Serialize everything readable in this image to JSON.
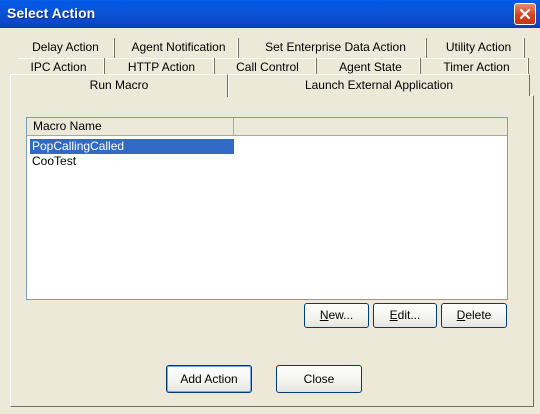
{
  "window": {
    "title": "Select Action"
  },
  "tabs": {
    "row1": [
      "Delay Action",
      "Agent Notification",
      "Set Enterprise Data Action",
      "Utility Action"
    ],
    "row2": [
      "IPC Action",
      "HTTP Action",
      "Call Control",
      "Agent State",
      "Timer Action"
    ],
    "row3": [
      "Run Macro",
      "Launch External Application"
    ],
    "active": "Run Macro"
  },
  "macro_list": {
    "columns": [
      "Macro Name",
      ""
    ],
    "rows": [
      {
        "name": "PopCallingCalled",
        "selected": true
      },
      {
        "name": "CooTest",
        "selected": false
      }
    ]
  },
  "list_buttons": {
    "new": {
      "label": "New...",
      "mnemonic": "N"
    },
    "edit": {
      "label": "Edit...",
      "mnemonic": "E"
    },
    "delete": {
      "label": "Delete",
      "mnemonic": "D"
    }
  },
  "footer_buttons": {
    "add_action": "Add Action",
    "close": "Close"
  },
  "colors": {
    "titlebar": "#0a54d8",
    "selection": "#316ac5",
    "dialog_bg": "#ece9d8"
  }
}
